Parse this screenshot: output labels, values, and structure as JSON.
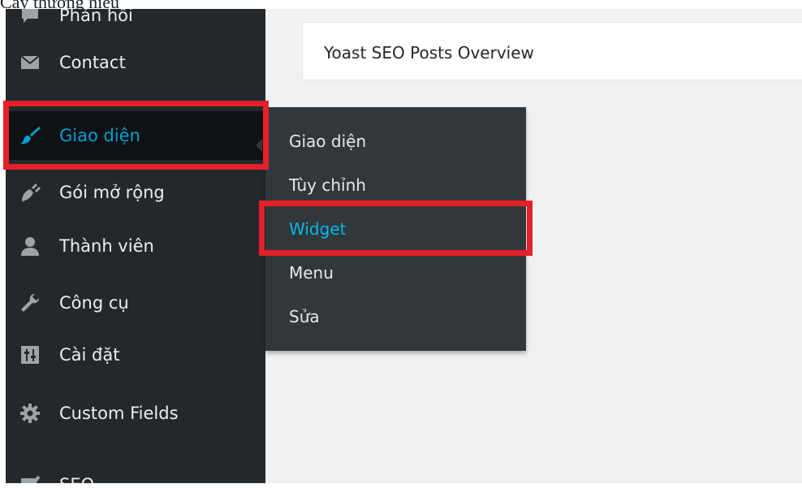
{
  "top_text": "Cấy thương hiệu",
  "sidebar": {
    "items": [
      {
        "label": "Phản hồi",
        "icon": "comment-icon"
      },
      {
        "label": "Contact",
        "icon": "envelope-icon"
      },
      {
        "label": "Giao diện",
        "icon": "paintbrush-icon",
        "active": true
      },
      {
        "label": "Gói mở rộng",
        "icon": "plugin-icon"
      },
      {
        "label": "Thành viên",
        "icon": "user-icon"
      },
      {
        "label": "Công cụ",
        "icon": "wrench-icon"
      },
      {
        "label": "Cài đặt",
        "icon": "settings-icon"
      },
      {
        "label": "Custom Fields",
        "icon": "gear-icon"
      },
      {
        "label": "SEO",
        "icon": "seo-icon"
      }
    ]
  },
  "submenu": {
    "items": [
      {
        "label": "Giao diện"
      },
      {
        "label": "Tùy chỉnh"
      },
      {
        "label": "Widget",
        "current": true
      },
      {
        "label": "Menu"
      },
      {
        "label": "Sửa"
      }
    ]
  },
  "dashboard": {
    "panel_title": "Yoast SEO Posts Overview"
  },
  "colors": {
    "sidebar_bg": "#23282d",
    "active_bg": "#0f1215",
    "submenu_bg": "#32373c",
    "accent": "#00a0d2",
    "highlight": "#e5202a"
  }
}
